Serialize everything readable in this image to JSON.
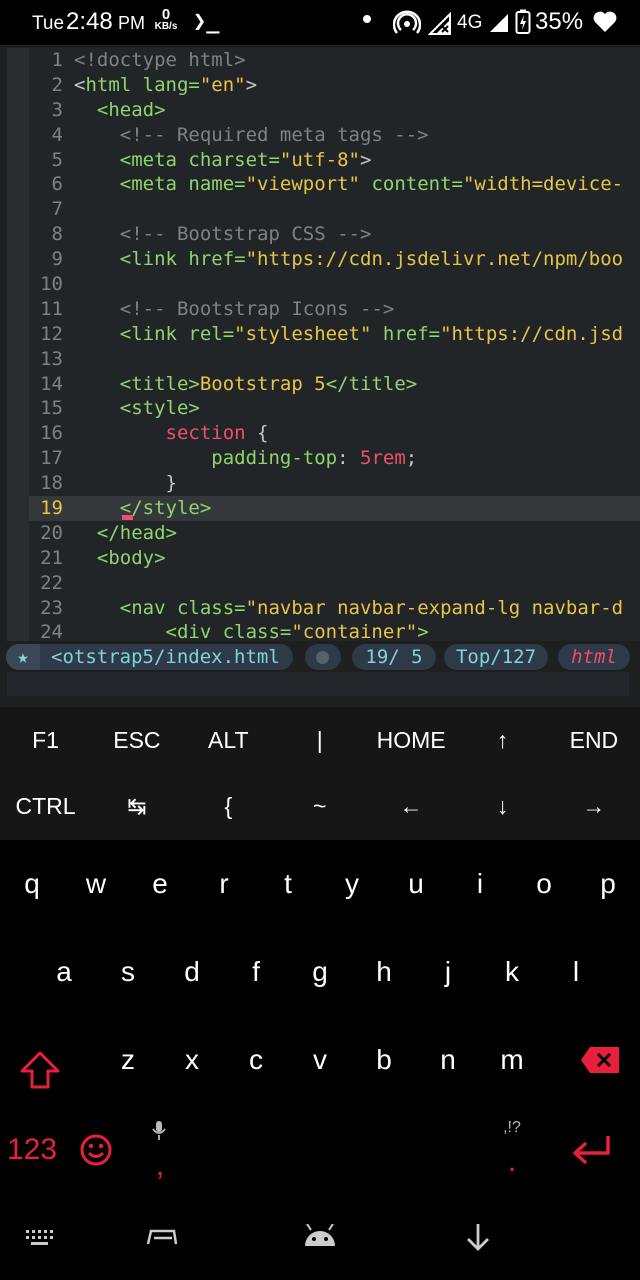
{
  "status_bar": {
    "day": "Tue",
    "time": "2:48",
    "ampm": "PM",
    "speed_value": "0",
    "speed_unit": "KB/s",
    "terminal_glyph": "❯_",
    "network_type": "4G",
    "battery_percent": "35%"
  },
  "editor": {
    "current_line": 19,
    "lines": [
      {
        "n": "1",
        "s": [
          [
            "<!doctype html>",
            "#7e8285"
          ]
        ]
      },
      {
        "n": "2",
        "s": [
          [
            "<",
            "#c5c8c6"
          ],
          [
            "html",
            "#8fd46e"
          ],
          [
            " lang=",
            "#8fd46e"
          ],
          [
            "\"en\"",
            "#e6c547"
          ],
          [
            ">",
            "#c5c8c6"
          ]
        ]
      },
      {
        "n": "3",
        "s": [
          [
            "  <",
            "#8fd46e"
          ],
          [
            "head",
            "#8fd46e"
          ],
          [
            ">",
            "#8fd46e"
          ]
        ]
      },
      {
        "n": "4",
        "s": [
          [
            "    <!-- Required meta tags -->",
            "#7e8285"
          ]
        ]
      },
      {
        "n": "5",
        "s": [
          [
            "    <",
            "#8fd46e"
          ],
          [
            "meta",
            "#8fd46e"
          ],
          [
            " charset=",
            "#8fd46e"
          ],
          [
            "\"utf-8\"",
            "#e6c547"
          ],
          [
            ">",
            "#c5c8c6"
          ]
        ]
      },
      {
        "n": "6",
        "s": [
          [
            "    <",
            "#8fd46e"
          ],
          [
            "meta",
            "#8fd46e"
          ],
          [
            " name=",
            "#8fd46e"
          ],
          [
            "\"viewport\"",
            "#e6c547"
          ],
          [
            " content=",
            "#8fd46e"
          ],
          [
            "\"width=device-",
            "#e6c547"
          ]
        ]
      },
      {
        "n": "7",
        "s": [
          [
            "",
            "#c5c8c6"
          ]
        ]
      },
      {
        "n": "8",
        "s": [
          [
            "    <!-- Bootstrap CSS -->",
            "#7e8285"
          ]
        ]
      },
      {
        "n": "9",
        "s": [
          [
            "    <",
            "#8fd46e"
          ],
          [
            "link",
            "#8fd46e"
          ],
          [
            " href=",
            "#8fd46e"
          ],
          [
            "\"https://cdn.jsdelivr.net/npm/boo",
            "#e6c547"
          ]
        ]
      },
      {
        "n": "10",
        "s": [
          [
            "",
            "#c5c8c6"
          ]
        ]
      },
      {
        "n": "11",
        "s": [
          [
            "    <!-- Bootstrap Icons -->",
            "#7e8285"
          ]
        ]
      },
      {
        "n": "12",
        "s": [
          [
            "    <",
            "#8fd46e"
          ],
          [
            "link",
            "#8fd46e"
          ],
          [
            " rel=",
            "#8fd46e"
          ],
          [
            "\"stylesheet\"",
            "#e6c547"
          ],
          [
            " href=",
            "#8fd46e"
          ],
          [
            "\"https://cdn.jsd",
            "#e6c547"
          ]
        ]
      },
      {
        "n": "13",
        "s": [
          [
            "",
            "#c5c8c6"
          ]
        ]
      },
      {
        "n": "14",
        "s": [
          [
            "    <",
            "#8fd46e"
          ],
          [
            "title",
            "#8fd46e"
          ],
          [
            ">",
            "#8fd46e"
          ],
          [
            "Bootstrap 5",
            "#e6c547"
          ],
          [
            "</title>",
            "#8fd46e"
          ]
        ]
      },
      {
        "n": "15",
        "s": [
          [
            "    <",
            "#8fd46e"
          ],
          [
            "style",
            "#8fd46e"
          ],
          [
            ">",
            "#8fd46e"
          ]
        ]
      },
      {
        "n": "16",
        "s": [
          [
            "        section",
            "#f04e6d"
          ],
          [
            " {",
            "#c5c8c6"
          ]
        ]
      },
      {
        "n": "17",
        "s": [
          [
            "            padding-top",
            "#8fd46e"
          ],
          [
            ": ",
            "#c5c8c6"
          ],
          [
            "5rem",
            "#f04e6d"
          ],
          [
            ";",
            "#c5c8c6"
          ]
        ]
      },
      {
        "n": "18",
        "s": [
          [
            "        }",
            "#c5c8c6"
          ]
        ]
      },
      {
        "n": "19",
        "s": [
          [
            "    <",
            "#8fd46e"
          ],
          [
            "/style",
            "#8fd46e"
          ],
          [
            ">",
            "#8fd46e"
          ]
        ]
      },
      {
        "n": "20",
        "s": [
          [
            "  </",
            "#8fd46e"
          ],
          [
            "head",
            "#8fd46e"
          ],
          [
            ">",
            "#8fd46e"
          ]
        ]
      },
      {
        "n": "21",
        "s": [
          [
            "  <",
            "#8fd46e"
          ],
          [
            "body",
            "#8fd46e"
          ],
          [
            ">",
            "#8fd46e"
          ]
        ]
      },
      {
        "n": "22",
        "s": [
          [
            "",
            "#c5c8c6"
          ]
        ]
      },
      {
        "n": "23",
        "s": [
          [
            "    <",
            "#8fd46e"
          ],
          [
            "nav",
            "#8fd46e"
          ],
          [
            " class=",
            "#8fd46e"
          ],
          [
            "\"navbar navbar-expand-lg navbar-d",
            "#e6c547"
          ]
        ]
      },
      {
        "n": "24",
        "s": [
          [
            "        <",
            "#8fd46e"
          ],
          [
            "div",
            "#8fd46e"
          ],
          [
            " class=",
            "#8fd46e"
          ],
          [
            "\"container\"",
            "#e6c547"
          ],
          [
            ">",
            "#8fd46e"
          ]
        ]
      }
    ]
  },
  "statusline": {
    "mode_icon": "★",
    "filename": "<otstrap5/index.html",
    "position": "19/ 5",
    "scroll": "Top/127",
    "filetype": "html"
  },
  "extra_keys": {
    "row1": [
      "F1",
      "ESC",
      "ALT",
      "|",
      "HOME",
      "↑",
      "END"
    ],
    "row2": [
      "CTRL",
      "↹",
      "{",
      "~",
      "←",
      "↓",
      "→"
    ]
  },
  "keyboard": {
    "row1": [
      "q",
      "w",
      "e",
      "r",
      "t",
      "y",
      "u",
      "i",
      "o",
      "p"
    ],
    "row2": [
      "a",
      "s",
      "d",
      "f",
      "g",
      "h",
      "j",
      "k",
      "l"
    ],
    "row3": [
      "z",
      "x",
      "c",
      "v",
      "b",
      "n",
      "m"
    ],
    "numbers_key": "123",
    "comma_key": ",",
    "period_key": ".",
    "punct_hint": ",!?"
  },
  "colors": {
    "accent": "#e8203d",
    "tag": "#8fd46e",
    "string": "#e6c547",
    "keyword": "#f04e6d",
    "statusline_fg": "#7fd4d8"
  }
}
